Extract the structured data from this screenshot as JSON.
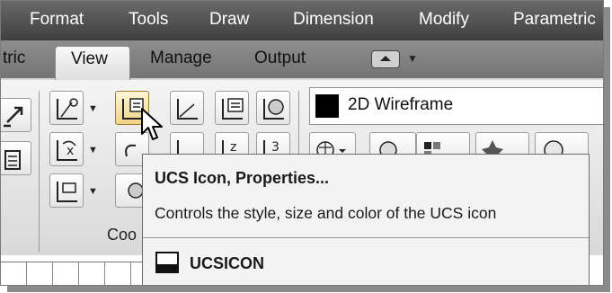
{
  "menubar": {
    "items": [
      "Format",
      "Tools",
      "Draw",
      "Dimension",
      "Modify",
      "Parametric"
    ]
  },
  "tabs": {
    "partial": "tric",
    "active": "View",
    "others": [
      "Manage",
      "Output"
    ]
  },
  "ribbon": {
    "visual_style": "2D Wireframe",
    "group_label_partial": "Coo"
  },
  "tooltip": {
    "title": "UCS Icon, Properties...",
    "description": "Controls the style, size and color of the UCS icon",
    "command": "UCSICON"
  },
  "icons": {
    "ucs_icon_properties": "ucs-icon-properties-icon",
    "cursor": "mouse-pointer-icon",
    "command": "ucsicon-command-icon"
  }
}
